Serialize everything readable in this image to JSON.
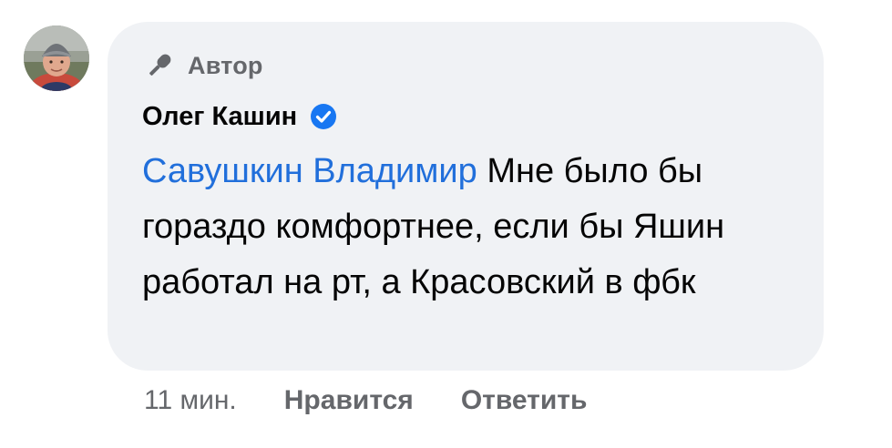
{
  "avatar": {
    "alt_icon": "user-avatar-photo"
  },
  "comment": {
    "badge_label": "Автор",
    "badge_icon": "microphone-icon",
    "author_name": "Олег Кашин",
    "verified_icon": "verified-check-icon",
    "mention": "Савушкин Владимир",
    "text": " Мне было бы гораздо комфортнее, если бы Яшин работал на рт, а Красовский в фбк"
  },
  "actions": {
    "time": "11 мин.",
    "like_label": "Нравится",
    "reply_label": "Ответить"
  },
  "colors": {
    "bubble": "#f0f2f5",
    "mention": "#216fdb",
    "secondary": "#65676b",
    "verified": "#1877f2"
  }
}
